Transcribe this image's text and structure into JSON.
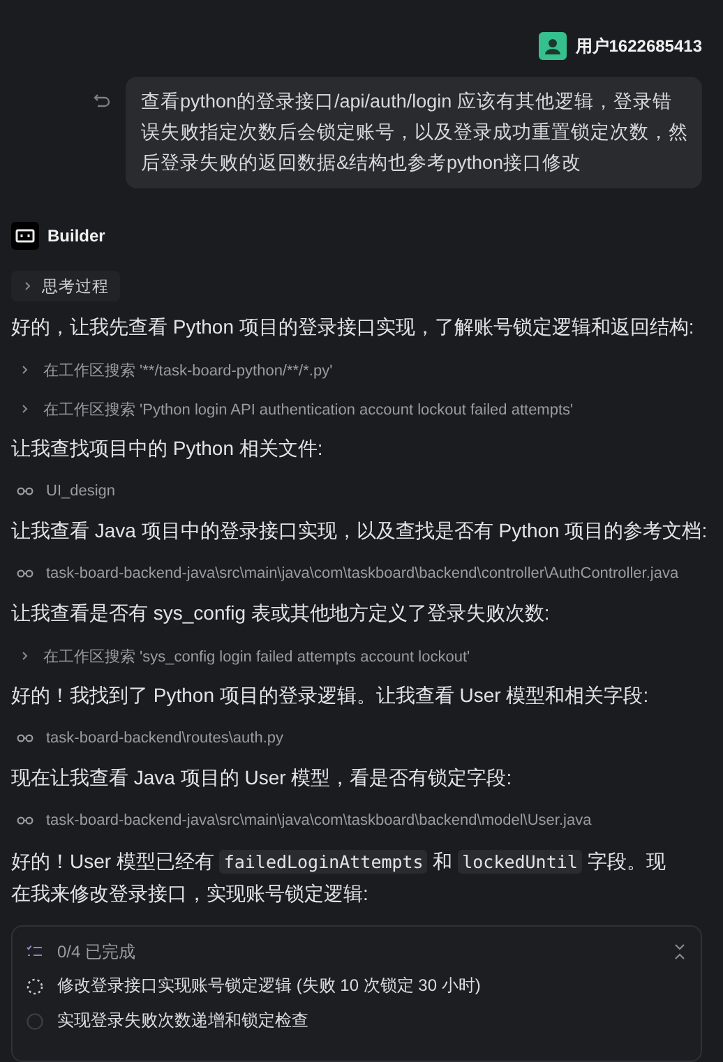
{
  "user": {
    "name": "用户1622685413"
  },
  "message": {
    "text": "查看python的登录接口/api/auth/login 应该有其他逻辑，登录错误失败指定次数后会锁定账号，以及登录成功重置锁定次数，然后登录失败的返回数据&结构也参考python接口修改"
  },
  "assistant": {
    "name": "Builder"
  },
  "thinking": {
    "label": "思考过程"
  },
  "steps": [
    {
      "kind": "text",
      "text": "好的，让我先查看 Python 项目的登录接口实现，了解账号锁定逻辑和返回结构:"
    },
    {
      "kind": "search",
      "text": "在工作区搜索 '**/task-board-python/**/*.py'"
    },
    {
      "kind": "search",
      "text": "在工作区搜索 'Python login API authentication account lockout failed attempts'"
    },
    {
      "kind": "text",
      "text": "让我查找项目中的 Python 相关文件:"
    },
    {
      "kind": "file",
      "text": "UI_design"
    },
    {
      "kind": "text",
      "text": "让我查看 Java 项目中的登录接口实现，以及查找是否有 Python 项目的参考文档:"
    },
    {
      "kind": "file",
      "text": "task-board-backend-java\\src\\main\\java\\com\\taskboard\\backend\\controller\\AuthController.java"
    },
    {
      "kind": "text",
      "text": "让我查看是否有 sys_config 表或其他地方定义了登录失败次数:"
    },
    {
      "kind": "search",
      "text": "在工作区搜索 'sys_config login failed attempts account lockout'"
    },
    {
      "kind": "text",
      "text": "好的！我找到了 Python 项目的登录逻辑。让我查看 User 模型和相关字段:"
    },
    {
      "kind": "file",
      "text": "task-board-backend\\routes\\auth.py"
    },
    {
      "kind": "text",
      "text": "现在让我查看 Java 项目的 User 模型，看是否有锁定字段:"
    },
    {
      "kind": "file",
      "text": "task-board-backend-java\\src\\main\\java\\com\\taskboard\\backend\\model\\User.java"
    }
  ],
  "paragraph": [
    {
      "kind": "text",
      "text": "好的！User 模型已经有 "
    },
    {
      "kind": "code",
      "text": "failedLoginAttempts"
    },
    {
      "kind": "text",
      "text": " 和 "
    },
    {
      "kind": "code",
      "text": "lockedUntil"
    },
    {
      "kind": "text",
      "text": " 字段。现在我来修改登录接口，实现账号锁定逻辑:"
    }
  ],
  "todo": {
    "summary": "0/4 已完成",
    "items": [
      {
        "text": "修改登录接口实现账号锁定逻辑 (失败 10 次锁定 30 小时)",
        "kind": "running"
      },
      {
        "text": "实现登录失败次数递增和锁定检查",
        "kind": "pending"
      }
    ]
  }
}
